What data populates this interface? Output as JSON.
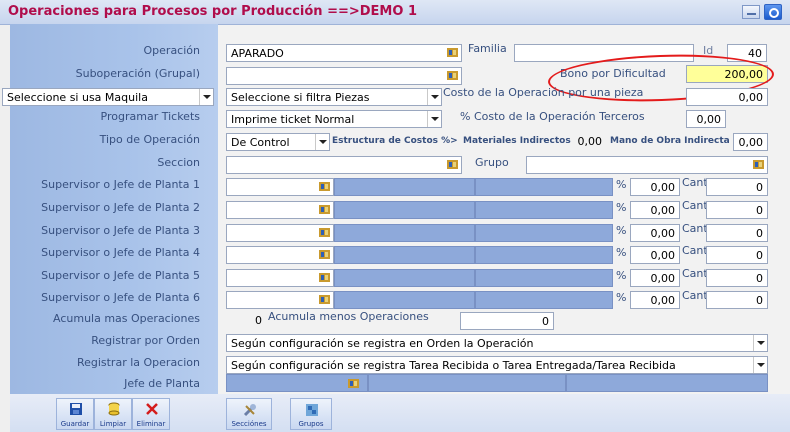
{
  "window": {
    "title": "Operaciones para Procesos por Producción ==>DEMO 1"
  },
  "labels": {
    "operacion": "Operación",
    "suboperacion": "Suboperación (Grupal)",
    "programar_tickets": "Programar Tickets",
    "tipo_operacion": "Tipo de Operación",
    "seccion": "Seccion",
    "supervisores": [
      "Supervisor o Jefe de Planta 1",
      "Supervisor o Jefe de Planta 2",
      "Supervisor o Jefe de Planta 3",
      "Supervisor o Jefe de Planta 4",
      "Supervisor o Jefe de Planta 5",
      "Supervisor o Jefe de Planta 6"
    ],
    "acumula_mas": "Acumula mas Operaciones",
    "acumula_menos": "Acumula menos Operaciones",
    "registrar_orden": "Registrar por Orden",
    "registrar_operacion": "Registrar la Operacion",
    "jefe_planta": "Jefe de Planta",
    "familia": "Familia",
    "id": "Id",
    "bono": "Bono por Dificultad",
    "costo_pieza": "Costo de la Operación por una pieza",
    "costo_terceros": "% Costo de la Operación Terceros",
    "estructura": "Estructura de Costos %>",
    "materiales": "Materiales Indirectos",
    "mano_obra": "Mano de Obra Indirecta",
    "grupo": "Grupo",
    "pct": "%",
    "cant": "Cant."
  },
  "values": {
    "operacion": "APARADO",
    "suboperacion": "",
    "familia": "",
    "id": "40",
    "bono": "200,00",
    "costo_pieza": "0,00",
    "costo_terceros": "0,00",
    "materiales": "0,00",
    "mano_obra": "0,00",
    "seccion": "",
    "grupo": "",
    "maquila_select": "Seleccione si usa Maquila",
    "piezas_select": "Seleccione si filtra Piezas",
    "ticket_select": "Imprime ticket Normal",
    "tipo_select": "De Control",
    "supervisor_pcts": [
      "0,00",
      "0,00",
      "0,00",
      "0,00",
      "0,00",
      "0,00"
    ],
    "supervisor_cants": [
      "0",
      "0",
      "0",
      "0",
      "0",
      "0"
    ],
    "acumula_mas": "0",
    "acumula_menos": "0",
    "registrar_orden": "Según configuración se registra en Orden la Operación",
    "registrar_operacion": "Según configuración se registra Tarea Recibida o Tarea Entregada/Tarea Recibida"
  },
  "toolbar": {
    "guardar": "Guardar",
    "limpiar": "Limpiar",
    "eliminar": "Eliminar",
    "secciones": "Secciónes",
    "grupos": "Grupos"
  },
  "colors": {
    "title": "#b00d4b",
    "panel": "#a9c3ea",
    "highlight": "#ffff99",
    "annotation": "#e41b1b"
  }
}
